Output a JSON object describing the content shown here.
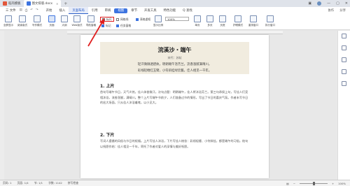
{
  "titlebar": {
    "tabs": [
      {
        "label": "稻壳模板",
        "color": "#e2573b"
      },
      {
        "label": "图文排版.docx",
        "color": "#3d74e0"
      }
    ],
    "plus": "+"
  },
  "menubar": {
    "file": "三 文件",
    "items": [
      "开始",
      "插入",
      "页面布局",
      "引用",
      "审阅",
      "视图",
      "章节",
      "开发工具",
      "特色功能"
    ],
    "highlight": "页面布局",
    "active": "视图",
    "search": "Q 查找",
    "right": [
      "协作",
      "分享"
    ]
  },
  "ribbon": {
    "buttons": [
      "全屏显示",
      "阅读版式",
      "写作模式",
      "页面",
      "大纲",
      "Web版式"
    ],
    "nav_button": "导航窗格",
    "checks": [
      {
        "label": "标尺",
        "checked": false
      },
      {
        "label": "网格线",
        "checked": false
      },
      {
        "label": "表格虚框",
        "checked": true
      },
      {
        "label": "标记",
        "checked": true
      },
      {
        "label": "任务窗格",
        "checked": true
      }
    ],
    "zoom_button": "显示比例",
    "zoom_value": "100%",
    "buttons_right": [
      "单页",
      "多页",
      "页宽",
      "护眼模式",
      "重排窗口",
      "拆分窗口"
    ]
  },
  "doc": {
    "title": "浣溪沙・端午",
    "author": "宋代：苏轼",
    "poem_lines": [
      "轻汗微微透碧纨，明朝端午浴芳兰。流香涨腻满晴川。",
      "彩线轻缠红玉臂，小符斜挂绿云鬟。佳人相见一千年。"
    ],
    "section1": "1. 上片",
    "para1": "首句写端午节日，天气炎热，佳人体香微汗。次句点题：明朝端午，佳人将沐浴芳兰。第三句承接上句，写佳人们竞相沐浴，流香涨腻，满晴川。整个上片写端午节前夕，人们准备过节的情形，写出了节日的喜庆气氛。作者未写节日的宏大场面，只从佳人沐浴着笔，以小见大。",
    "section2": "2. 下片",
    "para2": "写词人遵循的风俗与节日的祝福。上片写佳人沐浴，下片写佳人梳妆：彩线轻缠、小符斜挂，都是端午的习俗。结句以祝愿作结：佳人相见一千年，寄托了作者对爱人的深情与美好祝愿。"
  },
  "statusbar": {
    "page": "页码: 1",
    "pages": "页面: 1/4",
    "section": "节: 1/1",
    "words": "字数: 1142",
    "spell": "拼写检查",
    "zoom": "100%"
  }
}
